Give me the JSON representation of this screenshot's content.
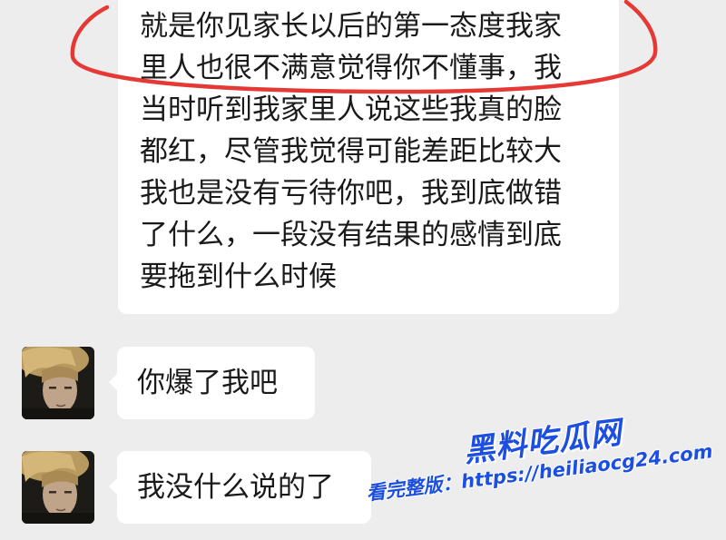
{
  "messages": [
    {
      "lines": [
        "就是你见家长以后的第一态度我家",
        "里人也很不满意觉得你不懂事，我",
        "当时听到我家里人说这些我真的脸",
        "都红，尽管我觉得可能差距比较大",
        "我也是没有亏待你吧，我到底做错",
        "了什么，一段没有结果的感情到底",
        "要拖到什么时候"
      ]
    },
    {
      "text": "你爆了我吧"
    },
    {
      "text": "我没什么说的了"
    }
  ],
  "watermark": {
    "title": "黑料吃瓜网",
    "url": "看完整版：https://heiliaocg24.com"
  },
  "colors": {
    "background": "#ededed",
    "bubble": "#ffffff",
    "text": "#1a1a1a",
    "highlight": "#e53935",
    "watermark": "#1c4fe0"
  }
}
